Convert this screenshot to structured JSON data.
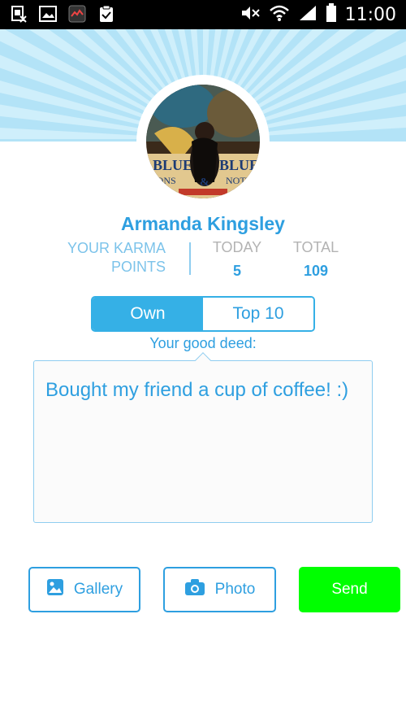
{
  "status_bar": {
    "time": "11:00"
  },
  "profile": {
    "name": "Armanda Kingsley"
  },
  "karma": {
    "label": "YOUR KARMA POINTS",
    "today_label": "TODAY",
    "today_value": "5",
    "total_label": "TOTAL",
    "total_value": "109"
  },
  "tabs": [
    {
      "label": "Own",
      "active": true
    },
    {
      "label": "Top 10",
      "active": false
    }
  ],
  "deed": {
    "caption": "Your good deed:",
    "text": "Bought my friend a cup of coffee! :)"
  },
  "actions": {
    "gallery_label": "Gallery",
    "photo_label": "Photo",
    "send_label": "Send"
  },
  "avatar_lettering": [
    "BLUE",
    "OONS",
    "BLUE",
    "NOTE",
    "&"
  ],
  "colors": {
    "accent": "#2e9fe0",
    "tab_active": "#35b0e6",
    "header": "#b3e3f7",
    "send": "#00ff00"
  }
}
